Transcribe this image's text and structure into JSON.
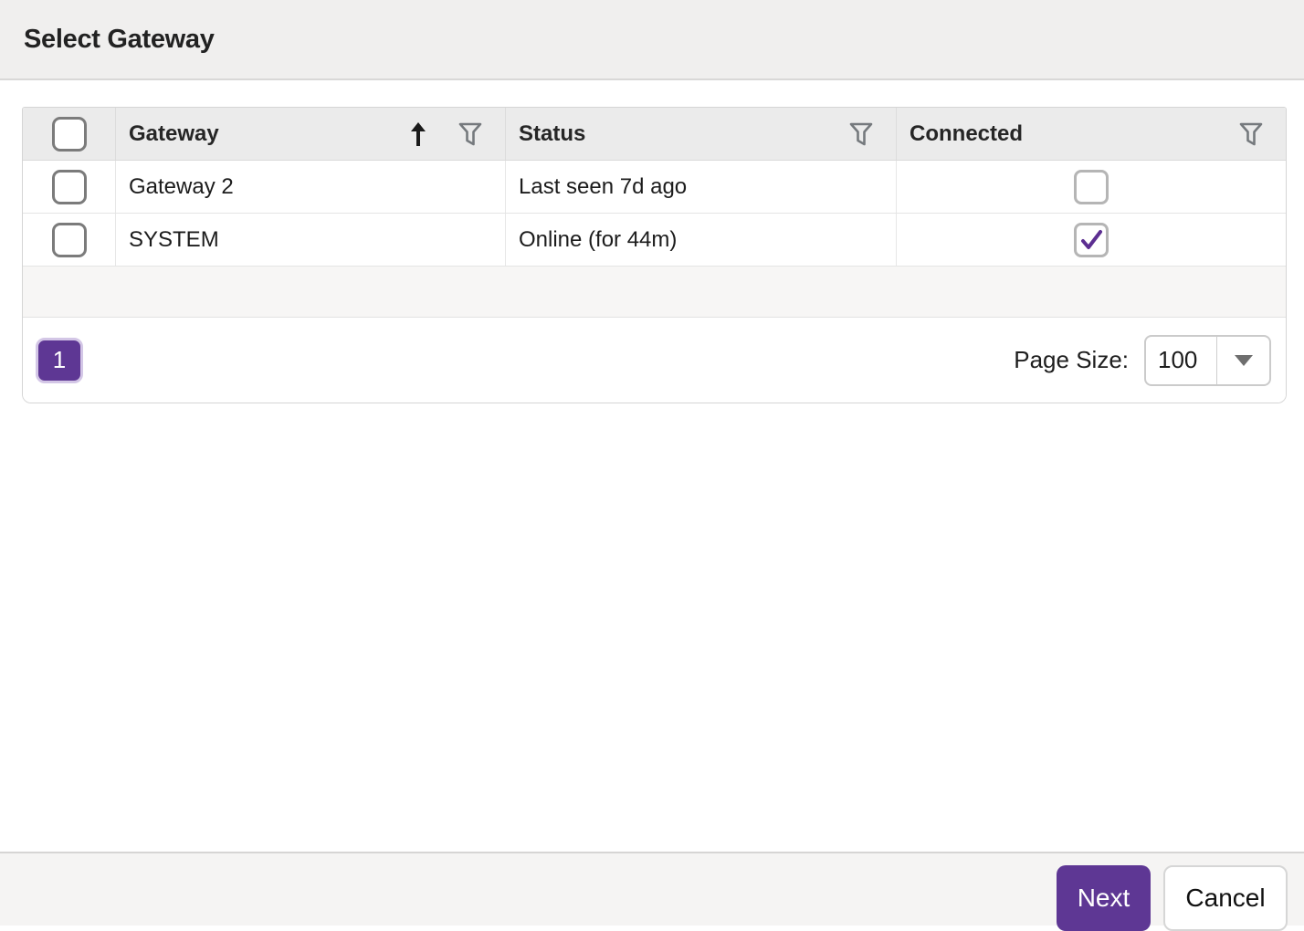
{
  "dialog": {
    "title": "Select Gateway"
  },
  "table": {
    "select_all": {
      "checked": false
    },
    "columns": [
      {
        "label": "Gateway",
        "sorted": "ascending",
        "has_filter": true
      },
      {
        "label": "Status",
        "sorted": null,
        "has_filter": true
      },
      {
        "label": "Connected",
        "sorted": null,
        "has_filter": true
      }
    ],
    "rows": [
      {
        "selected": false,
        "gateway": "Gateway 2",
        "status": "Last seen 7d ago",
        "connected": false
      },
      {
        "selected": false,
        "gateway": "SYSTEM",
        "status": "Online (for 44m)",
        "connected": true
      }
    ]
  },
  "pagination": {
    "current_page": "1",
    "page_size_label": "Page Size:",
    "page_size_value": "100"
  },
  "footer": {
    "next_label": "Next",
    "cancel_label": "Cancel"
  },
  "icons": {
    "sort_ascending": "up-arrow-icon",
    "filter": "funnel-icon",
    "dropdown": "caret-down-icon"
  },
  "colors": {
    "accent_purple": "#5e3794",
    "checkmark_purple": "#5c2e91",
    "titlebar_bg": "#f0efee",
    "table_header_bg": "#ebebeb",
    "footer_bg": "#f5f4f3"
  }
}
